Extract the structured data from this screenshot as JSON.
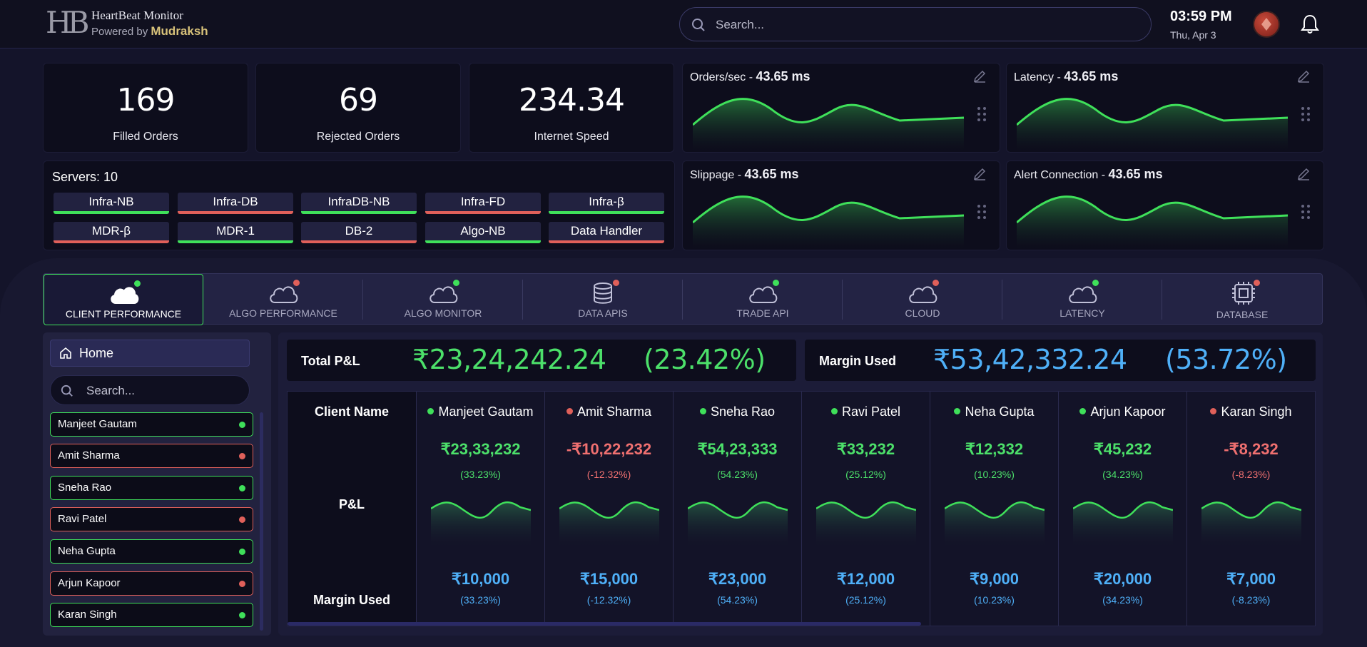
{
  "header": {
    "logo_text": "HB",
    "app_name": "HeartBeat Monitor",
    "powered_prefix": "Powered by",
    "powered_brand": "Mudraksh",
    "search_placeholder": "Search...",
    "time": "03:59 PM",
    "date": "Thu, Apr 3",
    "icons": [
      "search-icon",
      "avatar-icon",
      "bell-icon"
    ]
  },
  "stats": [
    {
      "value": "169",
      "label": "Filled Orders"
    },
    {
      "value": "69",
      "label": "Rejected Orders"
    },
    {
      "value": "234.34",
      "label": "Internet Speed"
    }
  ],
  "metrics": [
    {
      "name": "Orders/sec",
      "sep": " - ",
      "value": "43.65 ms"
    },
    {
      "name": "Latency",
      "sep": " - ",
      "value": "43.65 ms"
    },
    {
      "name": "Slippage",
      "sep": " - ",
      "value": "43.65 ms"
    },
    {
      "name": "Alert Connection",
      "sep": " - ",
      "value": "43.65 ms"
    }
  ],
  "servers": {
    "title": "Servers: 10",
    "items": [
      {
        "name": "Infra-NB",
        "status": "ok"
      },
      {
        "name": "Infra-DB",
        "status": "bad"
      },
      {
        "name": "InfraDB-NB",
        "status": "ok"
      },
      {
        "name": "Infra-FD",
        "status": "bad"
      },
      {
        "name": "Infra-β",
        "status": "ok"
      },
      {
        "name": "MDR-β",
        "status": "bad"
      },
      {
        "name": "MDR-1",
        "status": "ok"
      },
      {
        "name": "DB-2",
        "status": "bad"
      },
      {
        "name": "Algo-NB",
        "status": "ok"
      },
      {
        "name": "Data Handler",
        "status": "bad"
      }
    ]
  },
  "tabs": [
    {
      "label": "CLIENT PERFORMANCE",
      "icon": "cloud-icon",
      "status": "ok",
      "active": true
    },
    {
      "label": "ALGO PERFORMANCE",
      "icon": "cloud-icon",
      "status": "bad"
    },
    {
      "label": "ALGO MONITOR",
      "icon": "cloud-icon",
      "status": "ok"
    },
    {
      "label": "DATA APIS",
      "icon": "database-icon",
      "status": "bad"
    },
    {
      "label": "TRADE API",
      "icon": "cloud-icon",
      "status": "ok"
    },
    {
      "label": "CLOUD",
      "icon": "cloud-icon",
      "status": "bad"
    },
    {
      "label": "LATENCY",
      "icon": "cloud-icon",
      "status": "ok"
    },
    {
      "label": "DATABASE",
      "icon": "chip-icon",
      "status": "bad"
    }
  ],
  "sidebar": {
    "home_label": "Home",
    "search_placeholder": "Search...",
    "clients": [
      {
        "name": "Manjeet Gautam",
        "status": "ok"
      },
      {
        "name": "Amit Sharma",
        "status": "bad"
      },
      {
        "name": "Sneha Rao",
        "status": "ok"
      },
      {
        "name": "Ravi Patel",
        "status": "bad"
      },
      {
        "name": "Neha Gupta",
        "status": "ok"
      },
      {
        "name": "Arjun Kapoor",
        "status": "bad"
      },
      {
        "name": "Karan Singh",
        "status": "ok"
      }
    ]
  },
  "summary": {
    "pnl_label": "Total P&L",
    "pnl_value": "₹23,24,242.24",
    "pnl_pct": "(23.42%)",
    "margin_label": "Margin Used",
    "margin_value": "₹53,42,332.24",
    "margin_pct": "(53.72%)"
  },
  "table": {
    "row_labels": {
      "client": "Client Name",
      "pnl": "P&L",
      "margin": "Margin Used"
    },
    "columns": [
      {
        "name": "Manjeet Gautam",
        "status": "ok",
        "pnl": "₹23,33,232",
        "pnl_pct": "(33.23%)",
        "margin": "₹10,000",
        "margin_pct": "(33.23%)"
      },
      {
        "name": "Amit Sharma",
        "status": "bad",
        "pnl": "-₹10,22,232",
        "pnl_pct": "(-12.32%)",
        "margin": "₹15,000",
        "margin_pct": "(-12.32%)"
      },
      {
        "name": "Sneha Rao",
        "status": "ok",
        "pnl": "₹54,23,333",
        "pnl_pct": "(54.23%)",
        "margin": "₹23,000",
        "margin_pct": "(54.23%)"
      },
      {
        "name": "Ravi Patel",
        "status": "ok",
        "pnl": "₹33,232",
        "pnl_pct": "(25.12%)",
        "margin": "₹12,000",
        "margin_pct": "(25.12%)"
      },
      {
        "name": "Neha Gupta",
        "status": "ok",
        "pnl": "₹12,332",
        "pnl_pct": "(10.23%)",
        "margin": "₹9,000",
        "margin_pct": "(10.23%)"
      },
      {
        "name": "Arjun Kapoor",
        "status": "ok",
        "pnl": "₹45,232",
        "pnl_pct": "(34.23%)",
        "margin": "₹20,000",
        "margin_pct": "(34.23%)"
      },
      {
        "name": "Karan Singh",
        "status": "bad",
        "pnl": "-₹8,232",
        "pnl_pct": "(-8.23%)",
        "margin": "₹7,000",
        "margin_pct": "(-8.23%)"
      }
    ]
  },
  "colors": {
    "ok": "#3fe05a",
    "bad": "#e0605a",
    "blue": "#4fb0f8",
    "green_text": "#4ce06a",
    "red_text": "#f07070"
  }
}
